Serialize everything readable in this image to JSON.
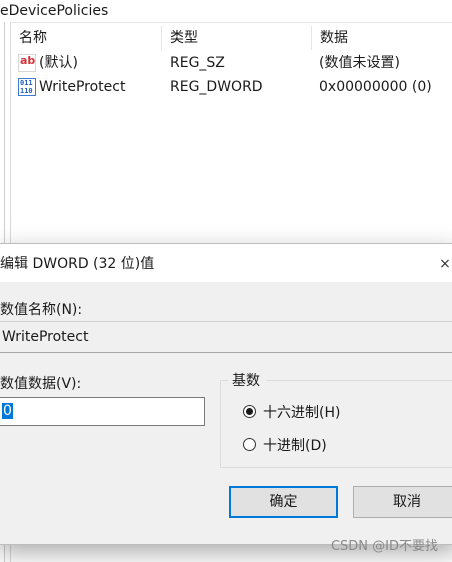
{
  "registry": {
    "path_fragment": "eDevicePolicies",
    "columns": [
      "名称",
      "类型",
      "数据"
    ],
    "rows": [
      {
        "name": "(默认)",
        "type": "REG_SZ",
        "data": "(数值未设置)",
        "icon": "string-value-icon"
      },
      {
        "name": "WriteProtect",
        "type": "REG_DWORD",
        "data": "0x00000000 (0)",
        "icon": "binary-value-icon"
      }
    ]
  },
  "dialog": {
    "title": "编辑 DWORD (32 位)值",
    "close_symbol": "×",
    "value_name_label": "数值名称(N):",
    "value_name": "WriteProtect",
    "value_data_label": "数值数据(V):",
    "value_data": "0",
    "base_group_label": "基数",
    "radio_hex_label": "十六进制(H)",
    "radio_dec_label": "十进制(D)",
    "selected_base": "hex",
    "ok_label": "确定",
    "cancel_label": "取消",
    "accent_color": "#0078d7"
  },
  "watermark": "CSDN @ID不要找"
}
